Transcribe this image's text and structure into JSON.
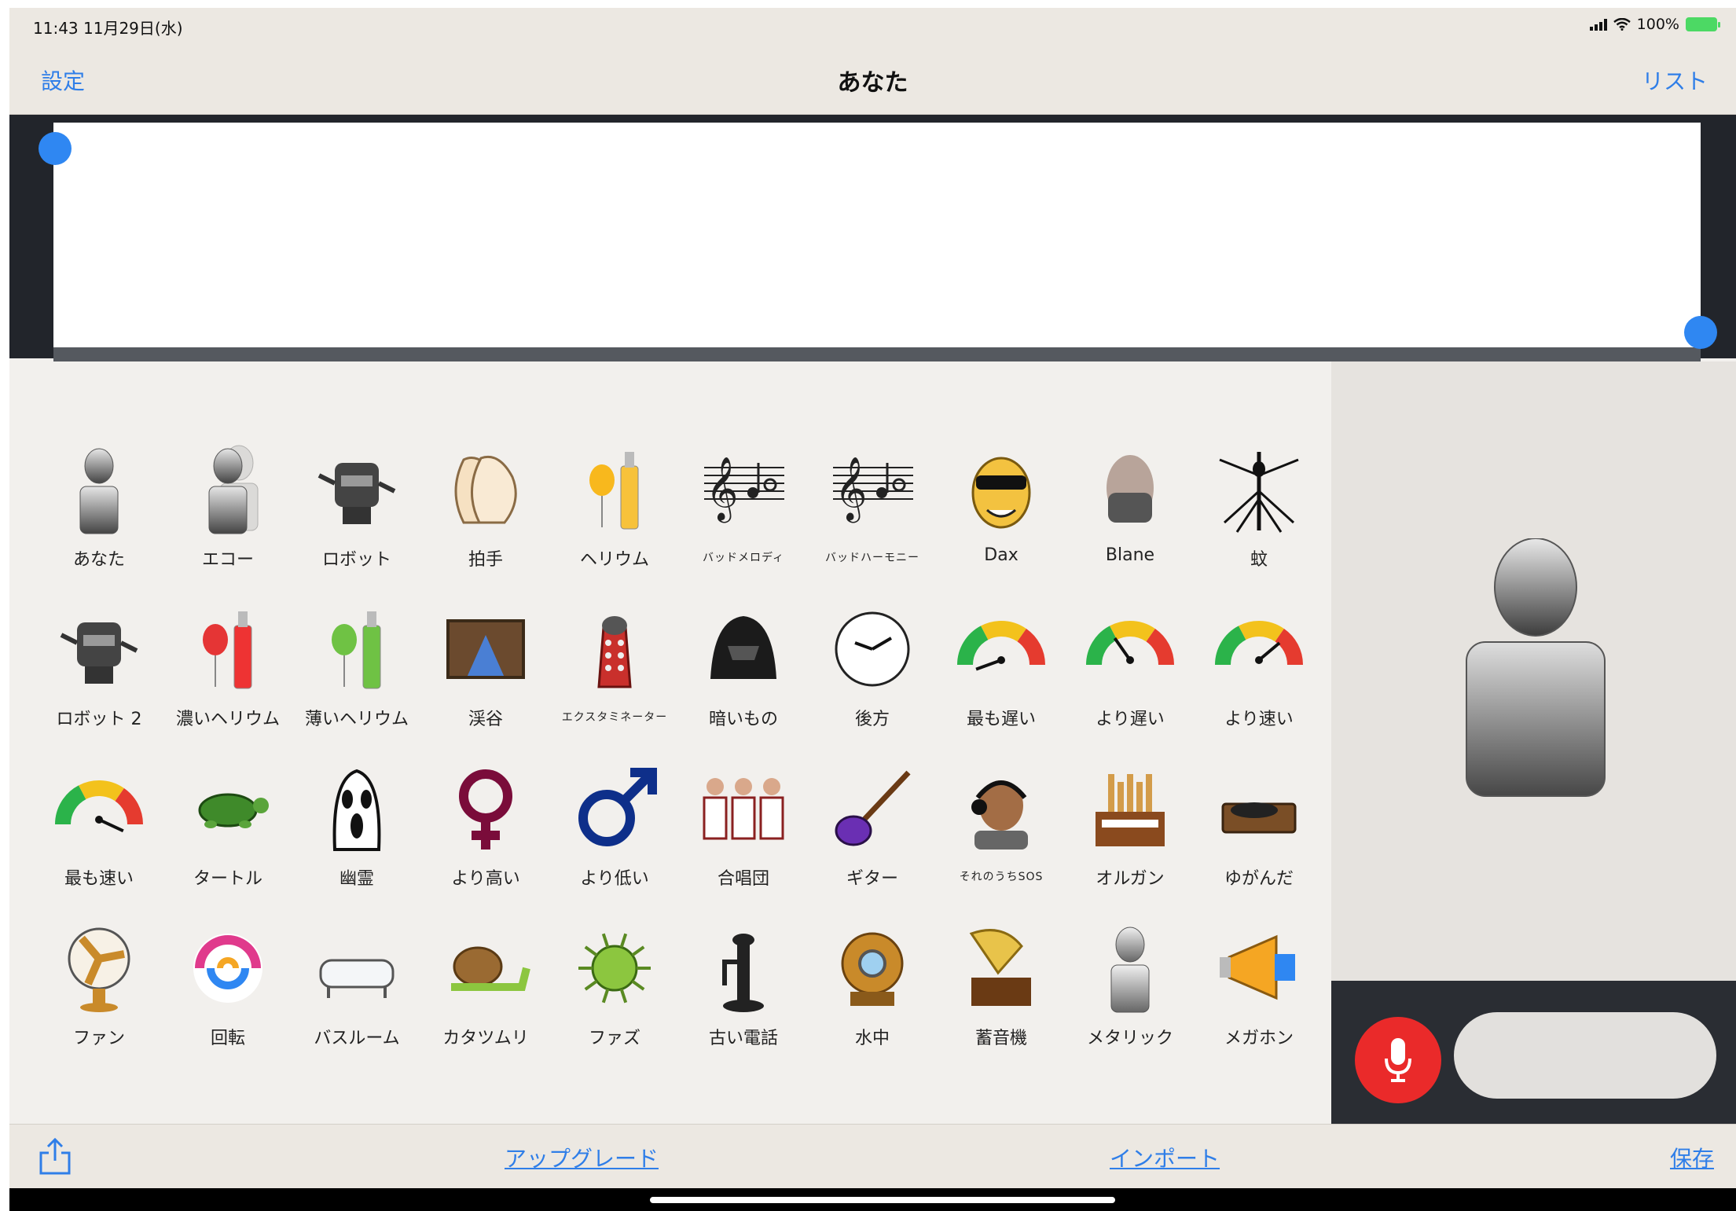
{
  "status_bar": {
    "time": "11:43  11月29日(水)",
    "battery": "100%"
  },
  "nav": {
    "settings_label": "設定",
    "title": "あなた",
    "list_label": "リスト"
  },
  "effects": [
    {
      "label": "あなた",
      "icon": "person-icon"
    },
    {
      "label": "エコー",
      "icon": "echo-person-icon"
    },
    {
      "label": "ロボット",
      "icon": "robot-icon"
    },
    {
      "label": "拍手",
      "icon": "clapping-hands-icon"
    },
    {
      "label": "ヘリウム",
      "icon": "helium-balloon-icon"
    },
    {
      "label": "バッドメロディ",
      "icon": "music-notes-icon",
      "small": true
    },
    {
      "label": "バッドハーモニー",
      "icon": "music-chord-icon",
      "small": true
    },
    {
      "label": "Dax",
      "icon": "dax-face-icon"
    },
    {
      "label": "Blane",
      "icon": "masked-man-icon"
    },
    {
      "label": "蚊",
      "icon": "mosquito-icon"
    },
    {
      "label": "ロボット 2",
      "icon": "robot-2-icon"
    },
    {
      "label": "濃いヘリウム",
      "icon": "red-balloon-icon"
    },
    {
      "label": "薄いヘリウム",
      "icon": "green-balloon-icon"
    },
    {
      "label": "渓谷",
      "icon": "canyon-icon"
    },
    {
      "label": "エクスタミネーター",
      "icon": "dalek-icon",
      "small": true
    },
    {
      "label": "暗いもの",
      "icon": "dark-helmet-icon"
    },
    {
      "label": "後方",
      "icon": "clock-icon"
    },
    {
      "label": "最も遅い",
      "icon": "gauge-slowest-icon"
    },
    {
      "label": "より遅い",
      "icon": "gauge-slower-icon"
    },
    {
      "label": "より速い",
      "icon": "gauge-faster-icon"
    },
    {
      "label": "最も速い",
      "icon": "gauge-fastest-icon"
    },
    {
      "label": "タートル",
      "icon": "turtle-icon"
    },
    {
      "label": "幽霊",
      "icon": "ghost-mask-icon"
    },
    {
      "label": "より高い",
      "icon": "female-symbol-icon"
    },
    {
      "label": "より低い",
      "icon": "male-symbol-icon"
    },
    {
      "label": "合唱団",
      "icon": "choir-icon"
    },
    {
      "label": "ギター",
      "icon": "guitar-icon"
    },
    {
      "label": "それのうちSOS",
      "icon": "headset-man-icon",
      "small": true
    },
    {
      "label": "オルガン",
      "icon": "organ-icon"
    },
    {
      "label": "ゆがんだ",
      "icon": "turntable-icon"
    },
    {
      "label": "ファン",
      "icon": "fan-icon"
    },
    {
      "label": "回転",
      "icon": "spiral-icon"
    },
    {
      "label": "バスルーム",
      "icon": "bathtub-icon"
    },
    {
      "label": "カタツムリ",
      "icon": "snail-icon"
    },
    {
      "label": "ファズ",
      "icon": "fuzz-virus-icon"
    },
    {
      "label": "古い電話",
      "icon": "old-phone-icon"
    },
    {
      "label": "水中",
      "icon": "diving-helmet-icon"
    },
    {
      "label": "蓄音機",
      "icon": "gramophone-icon"
    },
    {
      "label": "メタリック",
      "icon": "metal-person-icon"
    },
    {
      "label": "メガホン",
      "icon": "megaphone-icon"
    },
    {
      "label": "",
      "icon": "bird-icon"
    },
    {
      "label": "",
      "icon": "alien-icon"
    },
    {
      "label": "",
      "icon": "alien-ship-icon"
    },
    {
      "label": "",
      "icon": "helicopter-icon"
    },
    {
      "label": "",
      "icon": "flag-icon"
    },
    {
      "label": "",
      "icon": "storm-cloud-icon"
    },
    {
      "label": "",
      "icon": "island-icon"
    },
    {
      "label": "",
      "icon": "stadium-icon"
    },
    {
      "label": "",
      "icon": "slot-machine-icon"
    },
    {
      "label": "",
      "icon": "red-car-icon"
    }
  ],
  "bottom_bar": {
    "upgrade_label": "アップグレード",
    "import_label": "インポート",
    "save_label": "保存"
  },
  "colors": {
    "accent": "#2f7ee8",
    "record": "#ea2a2a",
    "handle": "#2f87f2"
  }
}
